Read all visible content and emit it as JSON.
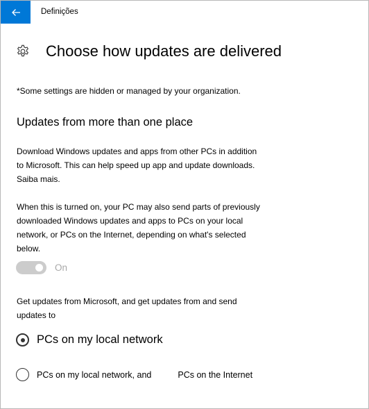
{
  "window": {
    "app_title": "Definições"
  },
  "header": {
    "title": "Choose how updates are delivered"
  },
  "note": "*Some settings are hidden or managed by your organization.",
  "section": {
    "title": "Updates from more than one place",
    "description_lines": [
      "Download Windows updates and apps from other PCs in addition",
      "to Microsoft. This can help speed up app and update downloads."
    ],
    "learn_more": "Saiba mais.",
    "detail_lines": [
      "When this is turned on, your PC may also send parts of previously",
      "downloaded Windows updates and apps to PCs on your local",
      "network, or PCs on the Internet, depending on what's selected",
      "below."
    ]
  },
  "toggle": {
    "state": "On",
    "enabled": false
  },
  "options": {
    "prompt_lines": [
      "Get updates from Microsoft, and get updates from and send",
      "updates to"
    ],
    "radio1_label": "PCs on my local network",
    "radio2_label_part1": "PCs on my local network, and",
    "radio2_label_part2": "PCs on the Internet",
    "selected": "radio1"
  },
  "icons": {
    "back": "back-arrow-icon",
    "settings": "gear-icon"
  },
  "colors": {
    "accent": "#0078d7",
    "toggle_disabled": "#cccccc"
  }
}
